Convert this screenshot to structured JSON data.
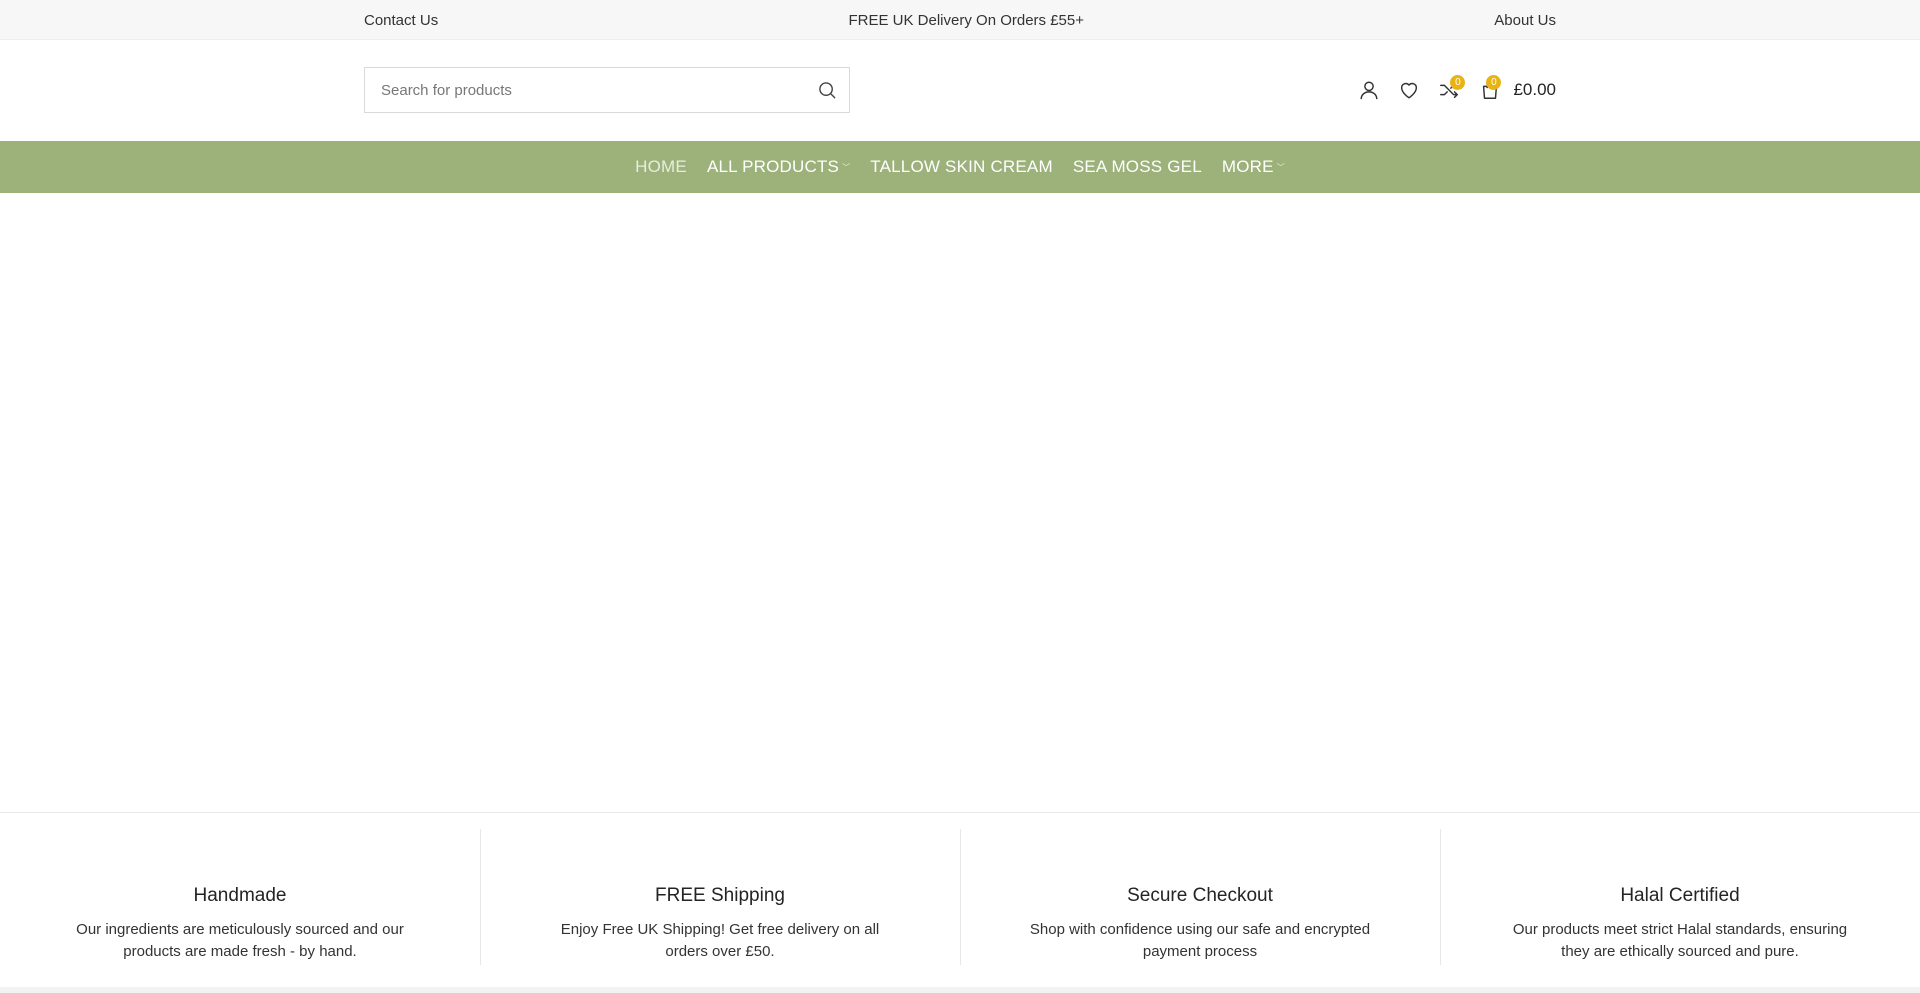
{
  "topbar": {
    "contact": "Contact Us",
    "delivery": "FREE UK Delivery On Orders £55+",
    "about": "About Us"
  },
  "search": {
    "placeholder": "Search for products"
  },
  "header": {
    "compare_count": "0",
    "cart_count": "0",
    "cart_total": "£0.00"
  },
  "nav": {
    "items": [
      {
        "label": "HOME"
      },
      {
        "label": "ALL PRODUCTS"
      },
      {
        "label": "TALLOW SKIN CREAM"
      },
      {
        "label": "SEA MOSS GEL"
      },
      {
        "label": "MORE"
      }
    ]
  },
  "features": [
    {
      "title": "Handmade",
      "text": "Our ingredients are meticulously sourced and our products are made fresh - by hand."
    },
    {
      "title": "FREE Shipping",
      "text": "Enjoy Free UK Shipping! Get free delivery on all orders over £50."
    },
    {
      "title": "Secure Checkout",
      "text": "Shop with confidence using our safe and encrypted payment process"
    },
    {
      "title": "Halal Certified",
      "text": "Our products meet strict Halal standards, ensuring they are ethically sourced and pure."
    }
  ],
  "colors": {
    "nav_bg": "#9cb27a",
    "badge": "#e9b413"
  }
}
